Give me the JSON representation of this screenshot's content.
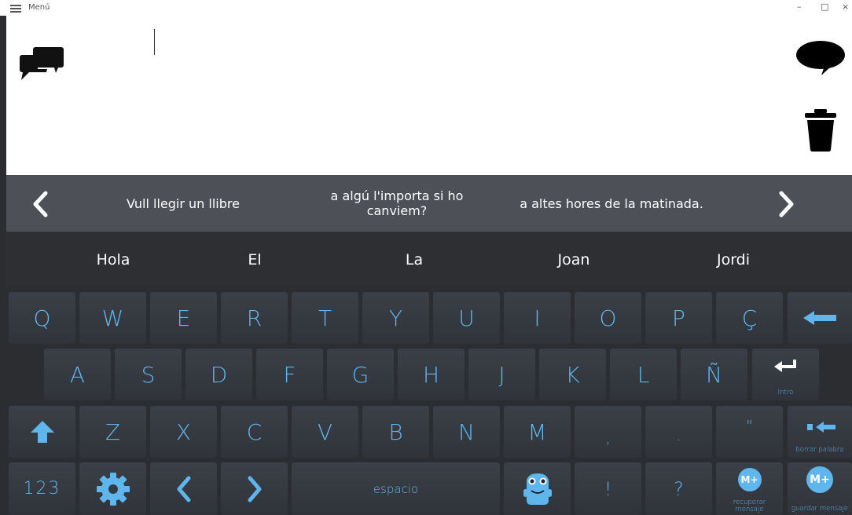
{
  "titlebar": {
    "menu_label": "Menú",
    "minimize": "–",
    "maximize": "□",
    "close": "×"
  },
  "sentences": [
    "Vull llegir un llibre",
    "a algú l'importa si ho canviem?",
    "a altes hores de la matinada."
  ],
  "words": [
    "Hola",
    "El",
    "La",
    "Joan",
    "Jordi"
  ],
  "keyboard": {
    "row1": [
      "Q",
      "W",
      "E",
      "R",
      "T",
      "Y",
      "U",
      "I",
      "O",
      "P",
      "Ç"
    ],
    "row2": [
      "A",
      "S",
      "D",
      "F",
      "G",
      "H",
      "J",
      "K",
      "L",
      "Ñ"
    ],
    "row3": [
      "Z",
      "X",
      "C",
      "V",
      "B",
      "N",
      "M",
      ",",
      ".",
      "\""
    ],
    "numbers_label": "123",
    "space_label": "espacio",
    "exclaim": "!",
    "question": "?",
    "enter_label": "Intro",
    "delete_word_label": "borrar palabra",
    "recover_label": "recuperar mensaje",
    "save_label": "guardar mensaje",
    "mplus": "M+"
  },
  "colors": {
    "accent": "#5fb6ec",
    "key_bg": "#363940",
    "suggest_bg": "#4d5056",
    "word_bg": "#2d2f33"
  }
}
